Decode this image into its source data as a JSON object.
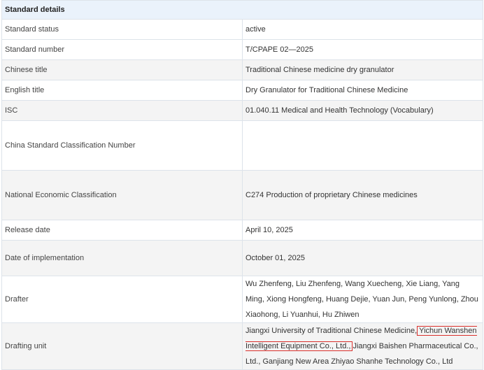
{
  "section_title": "Standard details",
  "rows": [
    {
      "label": "Standard status",
      "value": "active"
    },
    {
      "label": "Standard number",
      "value": "T/CPAPE 02—2025"
    },
    {
      "label": "Chinese title",
      "value": "Traditional Chinese medicine dry granulator"
    },
    {
      "label": "English title",
      "value": "Dry Granulator for Traditional Chinese Medicine"
    },
    {
      "label": "ISC",
      "value": "01.040.11 Medical and Health Technology (Vocabulary)"
    },
    {
      "label": "China Standard Classification Number",
      "value": ""
    },
    {
      "label": "National Economic Classification",
      "value": "C274 Production of proprietary Chinese medicines"
    },
    {
      "label": "Release date",
      "value": "April 10, 2025"
    },
    {
      "label": "Date of implementation",
      "value": "October 01, 2025"
    },
    {
      "label": "Drafter",
      "value": "Wu Zhenfeng, Liu Zhenfeng, Wang Xuecheng, Xie Liang, Yang Ming, Xiong Hongfeng, Huang Dejie, Yuan Jun, Peng Yunlong, Zhou Xiaohong, Li Yuanhui, Hu Zhiwen"
    },
    {
      "label": "Drafting unit",
      "value_part1": "Jiangxi University of Traditional Chinese Medicine,",
      "value_highlight": "Yichun Wanshen Intelligent Equipment Co., Ltd.,",
      "value_part2": "Jiangxi Baishen Pharmaceutical Co., Ltd., Ganjiang New Area Zhiyao Shanhe Technology Co., Ltd"
    }
  ],
  "colors": {
    "header_bg": "#eaf2fb",
    "alt_row_bg": "#f4f4f4",
    "border": "#dde3ea",
    "highlight": "#d9302c"
  }
}
